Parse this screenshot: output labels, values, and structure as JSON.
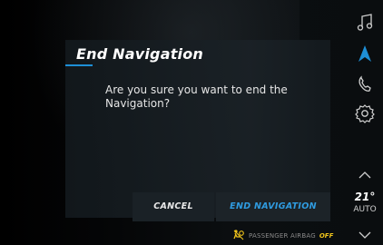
{
  "dialog": {
    "title": "End Navigation",
    "message": "Are you sure you want to end the Navigation?",
    "cancel_label": "CANCEL",
    "confirm_label": "END NAVIGATION"
  },
  "rail": {
    "icons": [
      "music-icon",
      "navigation-icon",
      "phone-icon",
      "settings-icon"
    ],
    "temperature": "21°",
    "climate_mode": "AUTO"
  },
  "status": {
    "airbag_text": "PASSENGER AIRBAG",
    "airbag_state": "OFF"
  },
  "colors": {
    "accent_blue": "#1e8fd6",
    "warning_yellow": "#f0c41b"
  }
}
